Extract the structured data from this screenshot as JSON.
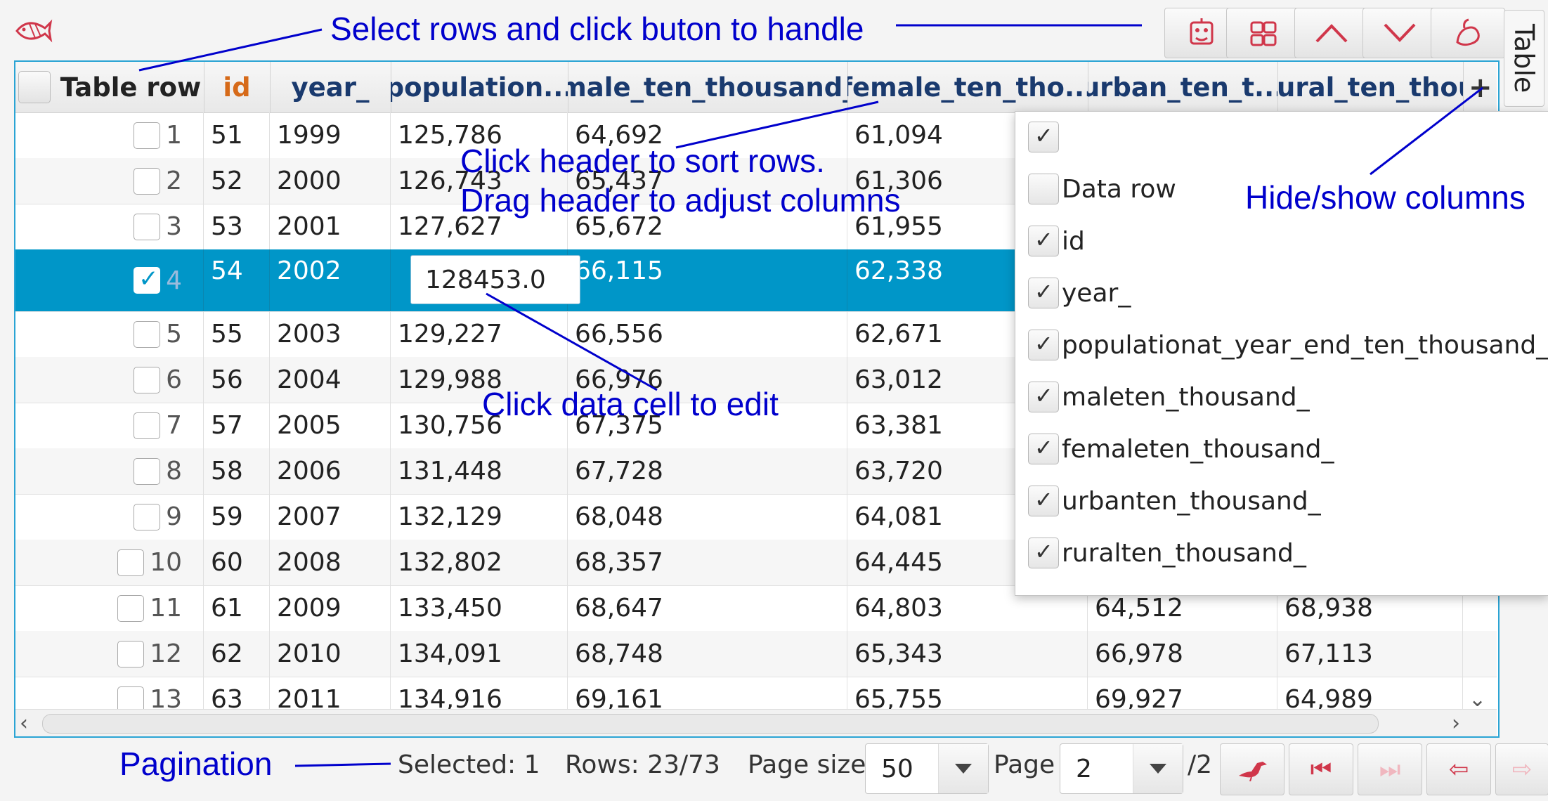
{
  "toolbar": {
    "side_tab_label": "Table",
    "buttons": [
      "handle-icon",
      "copy-icon",
      "move-up-icon",
      "move-down-icon",
      "clear-icon"
    ]
  },
  "table": {
    "headers": {
      "row": "Table row",
      "id": "id",
      "year": "year_",
      "population": "population...",
      "male": "male_ten_thousand_",
      "female": "female_ten_tho...",
      "urban": "urban_ten_t...",
      "rural": "rural_ten_thou"
    },
    "add_column": "+",
    "rows": [
      {
        "n": "1",
        "checked": false,
        "id": "51",
        "year": "1999",
        "population": "125,786",
        "male": "64,692",
        "female": "61,094",
        "urban": "",
        "rural": ""
      },
      {
        "n": "2",
        "checked": false,
        "id": "52",
        "year": "2000",
        "population": "126,743",
        "male": "65,437",
        "female": "61,306",
        "urban": "",
        "rural": ""
      },
      {
        "n": "3",
        "checked": false,
        "id": "53",
        "year": "2001",
        "population": "127,627",
        "male": "65,672",
        "female": "61,955",
        "urban": "",
        "rural": ""
      },
      {
        "n": "4",
        "checked": true,
        "id": "54",
        "year": "2002",
        "population": "128453.0",
        "male": "66,115",
        "female": "62,338",
        "urban": "",
        "rural": ""
      },
      {
        "n": "5",
        "checked": false,
        "id": "55",
        "year": "2003",
        "population": "129,227",
        "male": "66,556",
        "female": "62,671",
        "urban": "",
        "rural": ""
      },
      {
        "n": "6",
        "checked": false,
        "id": "56",
        "year": "2004",
        "population": "129,988",
        "male": "66,976",
        "female": "63,012",
        "urban": "",
        "rural": ""
      },
      {
        "n": "7",
        "checked": false,
        "id": "57",
        "year": "2005",
        "population": "130,756",
        "male": "67,375",
        "female": "63,381",
        "urban": "",
        "rural": ""
      },
      {
        "n": "8",
        "checked": false,
        "id": "58",
        "year": "2006",
        "population": "131,448",
        "male": "67,728",
        "female": "63,720",
        "urban": "",
        "rural": ""
      },
      {
        "n": "9",
        "checked": false,
        "id": "59",
        "year": "2007",
        "population": "132,129",
        "male": "68,048",
        "female": "64,081",
        "urban": "",
        "rural": ""
      },
      {
        "n": "10",
        "checked": false,
        "id": "60",
        "year": "2008",
        "population": "132,802",
        "male": "68,357",
        "female": "64,445",
        "urban": "",
        "rural": ""
      },
      {
        "n": "11",
        "checked": false,
        "id": "61",
        "year": "2009",
        "population": "133,450",
        "male": "68,647",
        "female": "64,803",
        "urban": "64,512",
        "rural": "68,938"
      },
      {
        "n": "12",
        "checked": false,
        "id": "62",
        "year": "2010",
        "population": "134,091",
        "male": "68,748",
        "female": "65,343",
        "urban": "66,978",
        "rural": "67,113"
      },
      {
        "n": "13",
        "checked": false,
        "id": "63",
        "year": "2011",
        "population": "134,916",
        "male": "69,161",
        "female": "65,755",
        "urban": "69,927",
        "rural": "64,989"
      }
    ]
  },
  "column_menu": {
    "items": [
      {
        "label": "",
        "checked": true
      },
      {
        "label": "Data row",
        "checked": false
      },
      {
        "label": "id",
        "checked": true
      },
      {
        "label": "year_",
        "checked": true
      },
      {
        "label": "populationat_year_end_ten_thousand_",
        "checked": true
      },
      {
        "label": "maleten_thousand_",
        "checked": true
      },
      {
        "label": "femaleten_thousand_",
        "checked": true
      },
      {
        "label": "urbanten_thousand_",
        "checked": true
      },
      {
        "label": "ruralten_thousand_",
        "checked": true
      }
    ]
  },
  "footer": {
    "selected": "Selected: 1",
    "rows": "Rows: 23/73",
    "page_size_label": "Page size",
    "page_size_value": "50",
    "page_label": "Page",
    "page_value": "2",
    "page_total": "/2"
  },
  "annotations": {
    "select_rows": "Select rows and click buton to handle",
    "sort_rows": "Click header to sort rows.",
    "drag_header": "Drag header to adjust columns",
    "hide_show": "Hide/show columns",
    "edit_cell": "Click data cell to edit",
    "pagination": "Pagination"
  },
  "colors": {
    "annotation": "#0000cc",
    "selection": "#0096c8",
    "table_border": "#2aa4d4",
    "header_text": "#1a3a6e",
    "id_header": "#d66a19",
    "button_icon": "#d0364a"
  }
}
